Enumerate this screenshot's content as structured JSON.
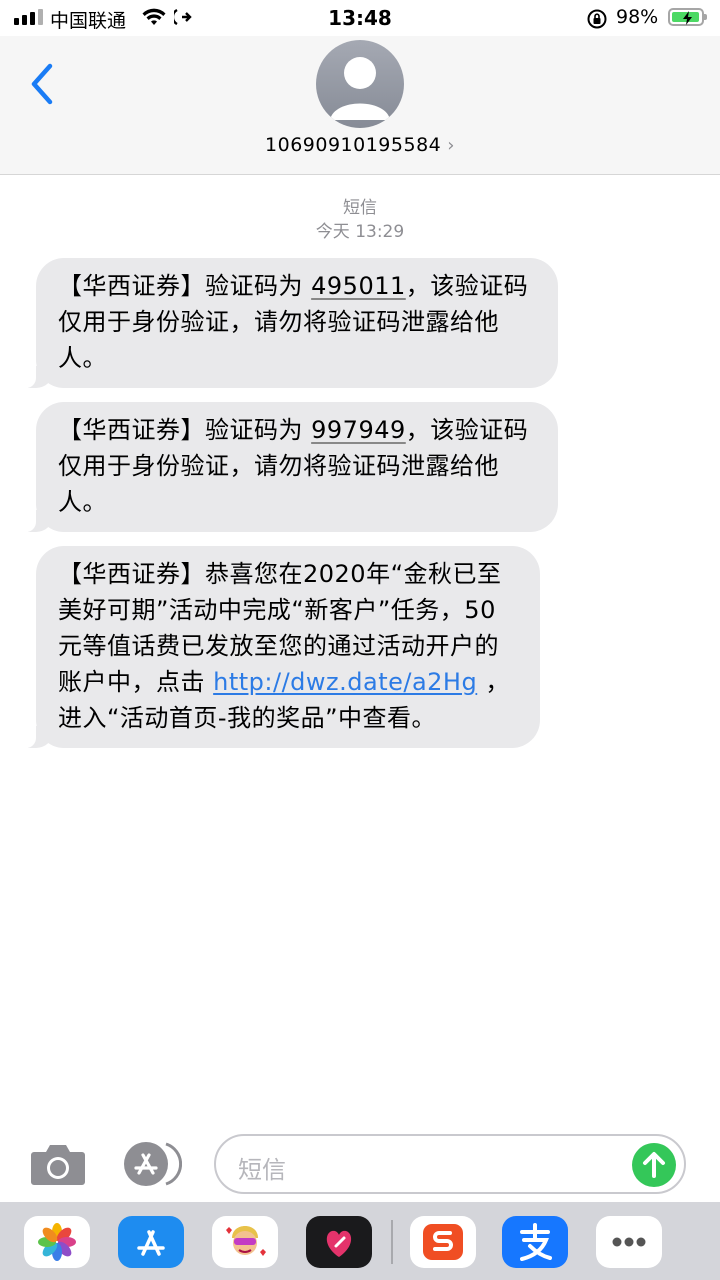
{
  "status_bar": {
    "carrier": "中国联通",
    "time": "13:48",
    "battery_percent": "98%",
    "battery_level": 0.98,
    "signal_bars": 4
  },
  "header": {
    "contact": "10690910195584",
    "chevron": "›"
  },
  "thread": {
    "service": "短信",
    "timestamp": "今天 13:29",
    "messages": [
      {
        "pre": "【华西证券】验证码为 ",
        "code": "495011",
        "post": "，该验证码仅用于身份验证，请勿将验证码泄露给他人。"
      },
      {
        "pre": "【华西证券】验证码为 ",
        "code": "997949",
        "post": "，该验证码仅用于身份验证，请勿将验证码泄露给他人。"
      },
      {
        "pre": "【华西证券】恭喜您在2020年“金秋已至 美好可期”活动中完成“新客户”任务，50元等值话费已发放至您的通过活动开户的账户中，点击 ",
        "link": "http://dwz.date/a2Hg",
        "post": " ，进入“活动首页-我的奖品”中查看。"
      }
    ]
  },
  "compose": {
    "placeholder": "短信"
  },
  "app_drawer": {
    "apps": [
      "photos-app",
      "app-store-app",
      "memoji-app",
      "digital-touch-app",
      "sogou-app",
      "alipay-app",
      "more-apps"
    ]
  },
  "colors": {
    "bubble": "#e9e9eb",
    "link": "#2c7be5",
    "send": "#34c759",
    "ios_blue": "#1a7cf5"
  }
}
